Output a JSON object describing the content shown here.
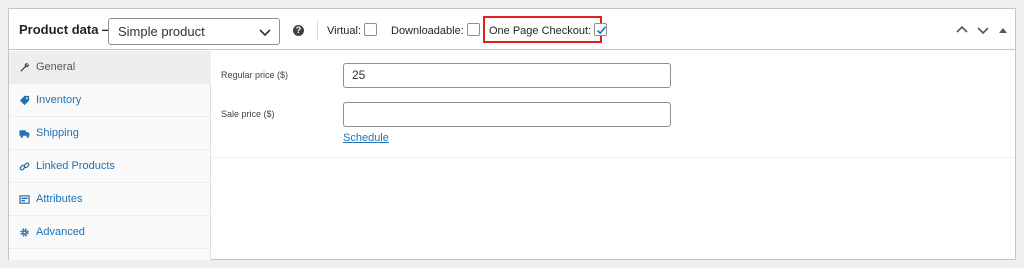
{
  "header": {
    "title": "Product data —",
    "product_type": "Simple product",
    "help_glyph": "?",
    "virtual_label": "Virtual:",
    "downloadable_label": "Downloadable:",
    "one_page_checkout_label": "One Page Checkout:"
  },
  "tabs": [
    {
      "label": "General",
      "icon": "wrench-icon"
    },
    {
      "label": "Inventory",
      "icon": "tag-icon"
    },
    {
      "label": "Shipping",
      "icon": "truck-icon"
    },
    {
      "label": "Linked Products",
      "icon": "link-icon"
    },
    {
      "label": "Attributes",
      "icon": "list-icon"
    },
    {
      "label": "Advanced",
      "icon": "gear-icon"
    }
  ],
  "general": {
    "regular_price_label": "Regular price ($)",
    "regular_price_value": "25",
    "sale_price_label": "Sale price ($)",
    "sale_price_value": "",
    "schedule_link": "Schedule"
  },
  "colors": {
    "link": "#2271b1",
    "highlight": "#e0201f",
    "border": "#c3c4c7"
  }
}
